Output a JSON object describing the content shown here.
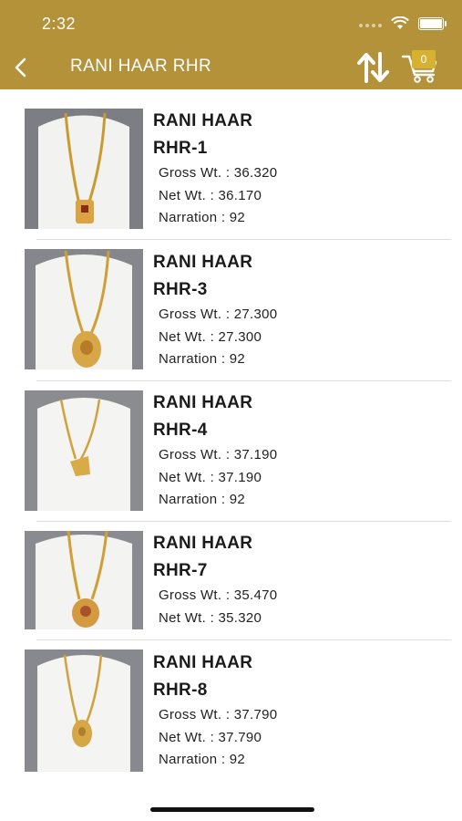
{
  "status_bar": {
    "time": "2:32"
  },
  "header": {
    "title": "RANI HAAR RHR",
    "cart_count": "0"
  },
  "colors": {
    "header_bg": "#b4923a",
    "cart_badge": "#d6b233"
  },
  "products": [
    {
      "name_line1": "RANI HAAR",
      "name_line2": "RHR-1",
      "gross_wt": "Gross Wt. : 36.320",
      "net_wt": "Net Wt. : 36.170",
      "narration": "Narration : 92"
    },
    {
      "name_line1": "RANI HAAR",
      "name_line2": "RHR-3",
      "gross_wt": "Gross Wt. : 27.300",
      "net_wt": "Net Wt. : 27.300",
      "narration": "Narration : 92"
    },
    {
      "name_line1": "RANI HAAR",
      "name_line2": "RHR-4",
      "gross_wt": "Gross Wt. : 37.190",
      "net_wt": "Net Wt. : 37.190",
      "narration": "Narration : 92"
    },
    {
      "name_line1": "RANI HAAR",
      "name_line2": "RHR-7",
      "gross_wt": "Gross Wt. : 35.470",
      "net_wt": "Net Wt. : 35.320",
      "narration": ""
    },
    {
      "name_line1": "RANI HAAR",
      "name_line2": "RHR-8",
      "gross_wt": "Gross Wt. : 37.790",
      "net_wt": "Net Wt. : 37.790",
      "narration": "Narration : 92"
    }
  ]
}
